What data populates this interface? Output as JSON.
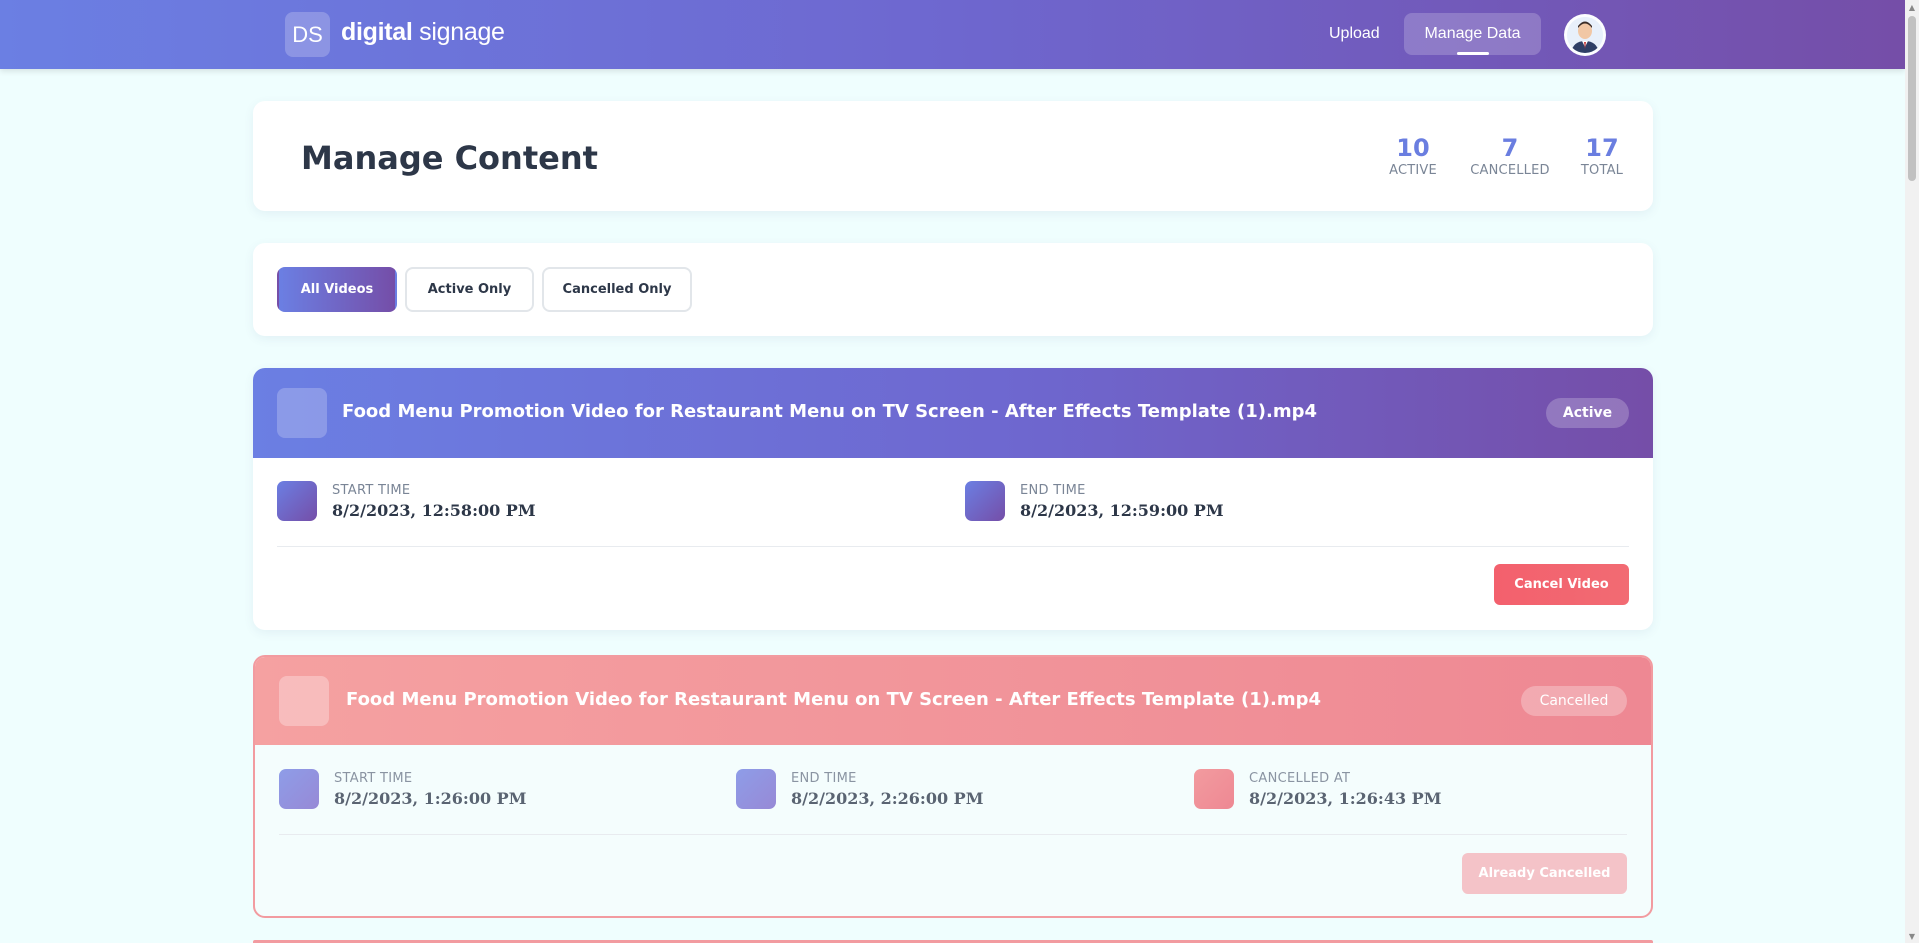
{
  "header": {
    "logo_text": "DS",
    "brand_bold": "digital",
    "brand_light": "signage",
    "nav": {
      "upload": "Upload",
      "manage": "Manage Data"
    }
  },
  "summary": {
    "title": "Manage Content",
    "stats": [
      {
        "value": "10",
        "label": "ACTIVE"
      },
      {
        "value": "7",
        "label": "CANCELLED"
      },
      {
        "value": "17",
        "label": "TOTAL"
      }
    ]
  },
  "filters": {
    "all": "All Videos",
    "active": "Active Only",
    "cancelled": "Cancelled Only",
    "selected": "all"
  },
  "videos": [
    {
      "title": "Food Menu Promotion Video for Restaurant Menu on TV Screen - After Effects Template (1).mp4",
      "status": "Active",
      "start_label": "START TIME",
      "start_value": "8/2/2023, 12:58:00 PM",
      "end_label": "END TIME",
      "end_value": "8/2/2023, 12:59:00 PM",
      "action": "Cancel Video"
    },
    {
      "title": "Food Menu Promotion Video for Restaurant Menu on TV Screen - After Effects Template (1).mp4",
      "status": "Cancelled",
      "start_label": "START TIME",
      "start_value": "8/2/2023, 1:26:00 PM",
      "end_label": "END TIME",
      "end_value": "8/2/2023, 2:26:00 PM",
      "cancelled_label": "CANCELLED AT",
      "cancelled_value": "8/2/2023, 1:26:43 PM",
      "action": "Already Cancelled"
    }
  ],
  "colors": {
    "accent": "#6b7fe3",
    "accent_end": "#754ea8",
    "danger": "#f3606d",
    "page_bg": "#effefe"
  }
}
